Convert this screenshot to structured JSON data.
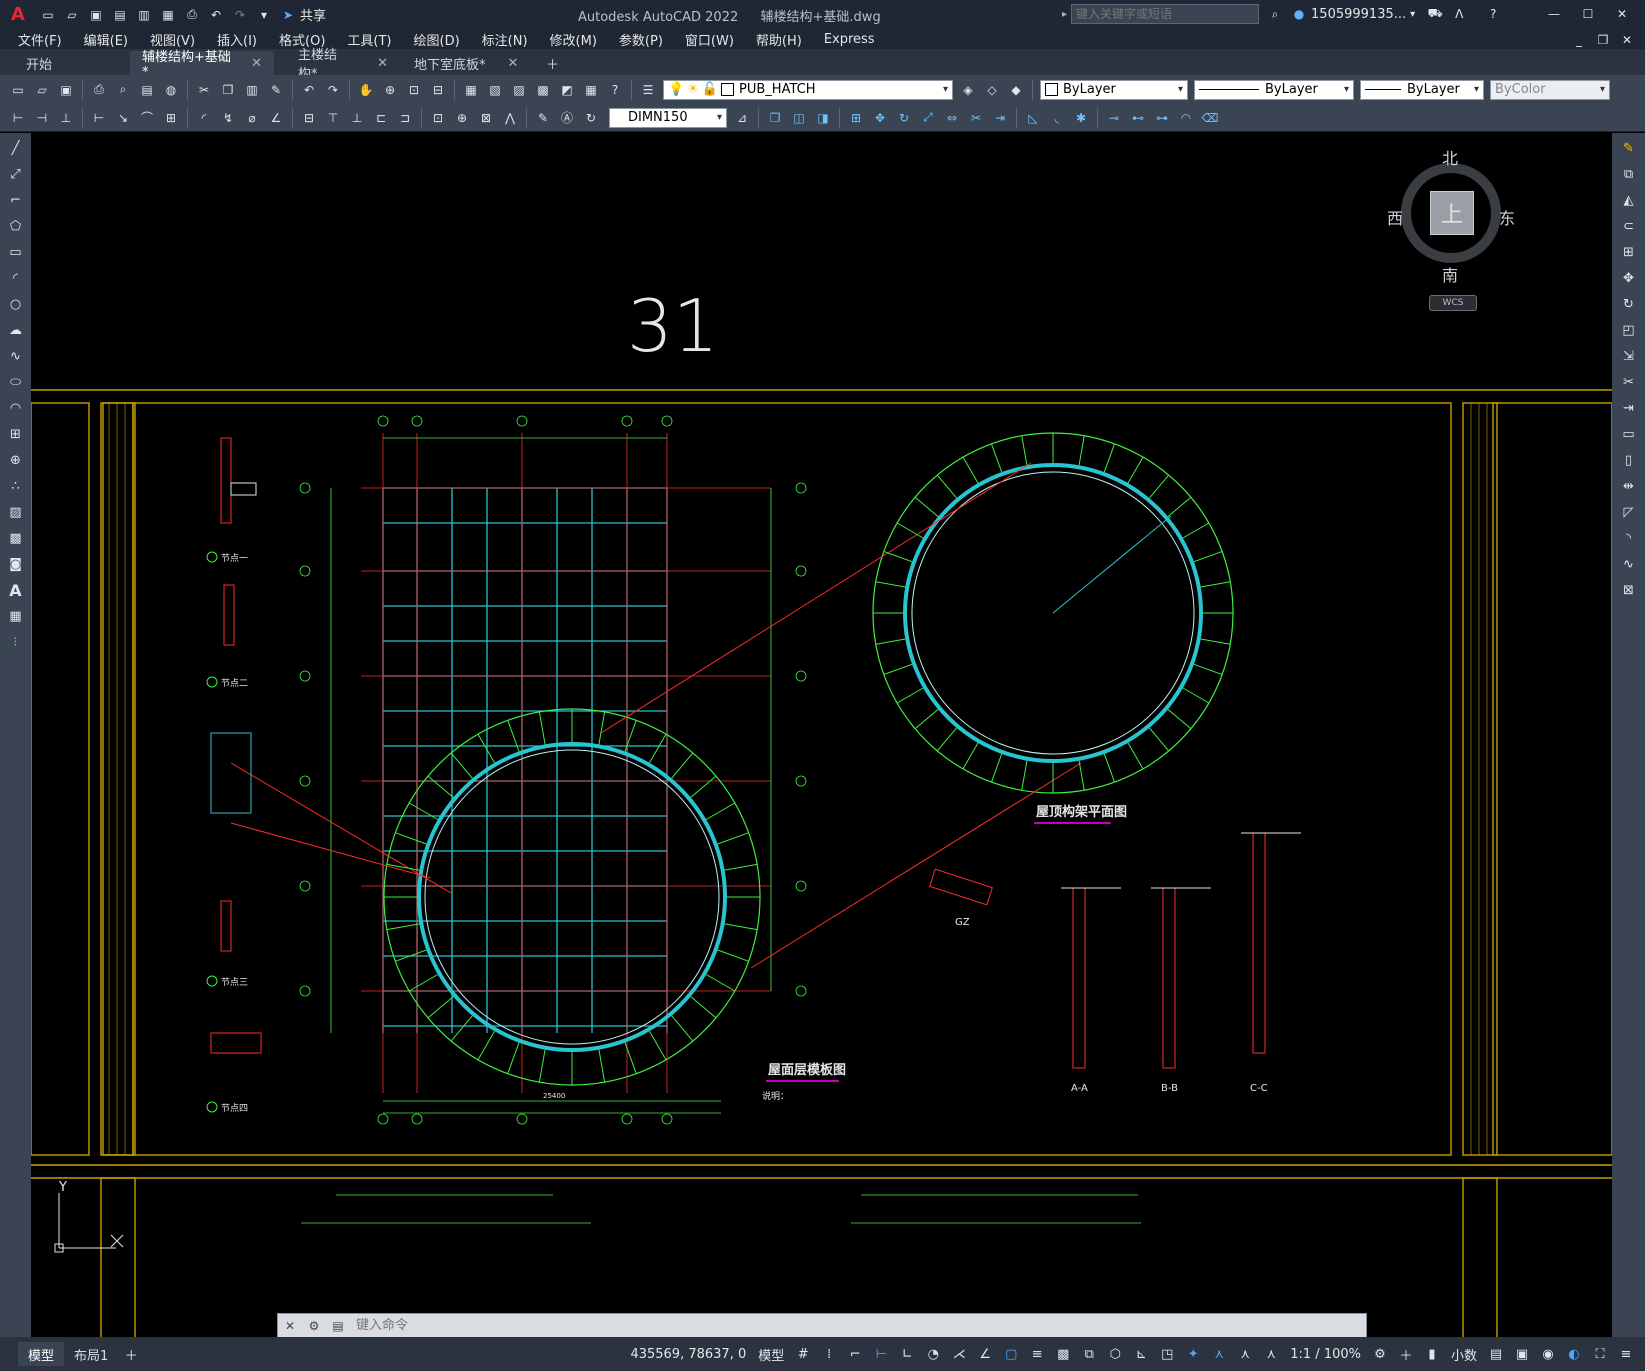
{
  "app": {
    "logo": "A",
    "title": "Autodesk AutoCAD 2022",
    "filename": "辅楼结构+基础.dwg",
    "share_label": "共享",
    "search_placeholder": "键入关键字或短语",
    "user": "1505999135...",
    "window_buttons": [
      "minimize-icon",
      "maximize-icon",
      "close-icon"
    ]
  },
  "menu": [
    "文件(F)",
    "编辑(E)",
    "视图(V)",
    "插入(I)",
    "格式(O)",
    "工具(T)",
    "绘图(D)",
    "标注(N)",
    "修改(M)",
    "参数(P)",
    "窗口(W)",
    "帮助(H)",
    "Express"
  ],
  "tabs": [
    {
      "label": "开始",
      "closable": false,
      "active": false
    },
    {
      "label": "辅楼结构+基础*",
      "closable": true,
      "active": true
    },
    {
      "label": "主楼结构*",
      "closable": true,
      "active": false
    },
    {
      "label": "地下室底板*",
      "closable": true,
      "active": false
    }
  ],
  "toolbar": {
    "layer": "PUB_HATCH",
    "color": "ByLayer",
    "linetype": "ByLayer",
    "lineweight": "ByLayer",
    "plotstyle": "ByColor",
    "dimstyle": "DIMN150"
  },
  "viewcube": {
    "north": "北",
    "south": "南",
    "east": "东",
    "west": "西",
    "face": "上",
    "ucs": "WCS"
  },
  "drawing": {
    "sheet_number": "31",
    "title_roof_truss": "屋顶构架平面图",
    "title_roof_formwork": "屋面层模板图",
    "note_title": "说明：",
    "section_labels": [
      "A-A",
      "B-B",
      "C-C"
    ],
    "gz_label": "GZ",
    "node_labels": [
      "节点一",
      "节点二",
      "节点三",
      "节点四"
    ],
    "total_dim": "25400",
    "ucs_y": "Y"
  },
  "command": {
    "placeholder": "键入命令"
  },
  "status": {
    "layout_tabs": [
      "模型",
      "布局1"
    ],
    "coordinates": "435569, 78637, 0",
    "model_label": "模型",
    "scale": "1:1 / 100%",
    "units": "小数"
  }
}
